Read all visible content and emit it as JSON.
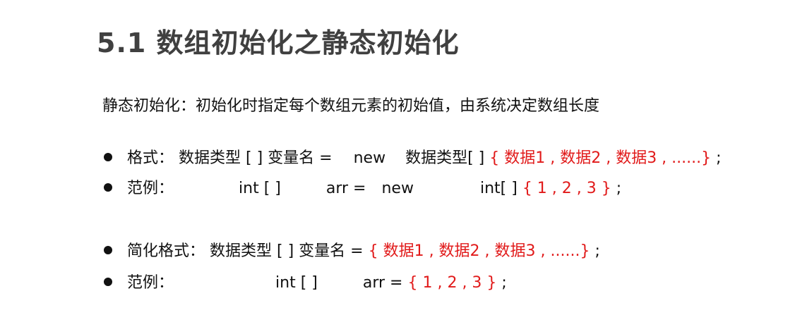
{
  "title": "5.1 数组初始化之静态初始化",
  "intro": "静态初始化：初始化时指定每个数组元素的初始值，由系统决定数组长度",
  "lines": [
    {
      "label": "格式：",
      "code1": "数据类型 [ ] 变量名 =",
      "code2": "new",
      "code3": "数据类型[ ]",
      "value": "{ 数据1 , 数据2 , 数据3 , ......}",
      "end": ";"
    },
    {
      "label": "范例：",
      "code1": "int [ ]",
      "code2": "arr =",
      "code3": "new",
      "code4": "int[ ]",
      "value": "{ 1 , 2 , 3 }",
      "end": ";"
    },
    {
      "label": "简化格式：",
      "code1": "数据类型 [ ] 变量名 =",
      "value": "{ 数据1 , 数据2 , 数据3 , ......}",
      "end": ";"
    },
    {
      "label": "范例：",
      "code1": "int [ ]",
      "code2": "arr =",
      "value": "{ 1 , 2 , 3 }",
      "end": ";"
    }
  ]
}
